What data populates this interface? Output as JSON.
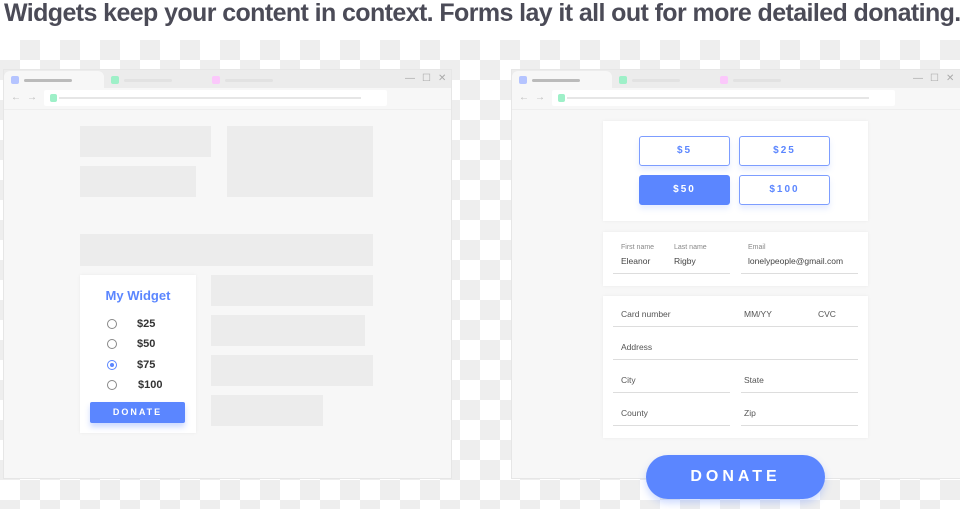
{
  "headline": "Widgets keep your content in context.  Forms lay it all out for more detailed donating.",
  "colors": {
    "accent": "#5b86ff",
    "tab_blue": "#b5c4ff",
    "tab_green": "#9ef0c8",
    "tab_pink": "#fbc8fb"
  },
  "icons": {
    "back": "←",
    "forward": "→",
    "minimize": "—",
    "maximize": "☐",
    "close": "✕"
  },
  "widget": {
    "title": "My Widget",
    "options": [
      "$25",
      "$50",
      "$75",
      "$100"
    ],
    "selected_index": 2,
    "donate_label": "DONATE"
  },
  "form": {
    "amounts": [
      "$5",
      "$25",
      "$50",
      "$100"
    ],
    "selected_amount": "$50",
    "first_name": {
      "label": "First name",
      "value": "Eleanor"
    },
    "last_name": {
      "label": "Last name",
      "value": "Rigby"
    },
    "email": {
      "label": "Email",
      "value": "lonelypeople@gmail.com"
    },
    "card_number": "Card number",
    "expiry": "MM/YY",
    "cvc": "CVC",
    "address": "Address",
    "city": "City",
    "state": "State",
    "county": "County",
    "zip": "Zip",
    "donate_label": "DONATE"
  }
}
